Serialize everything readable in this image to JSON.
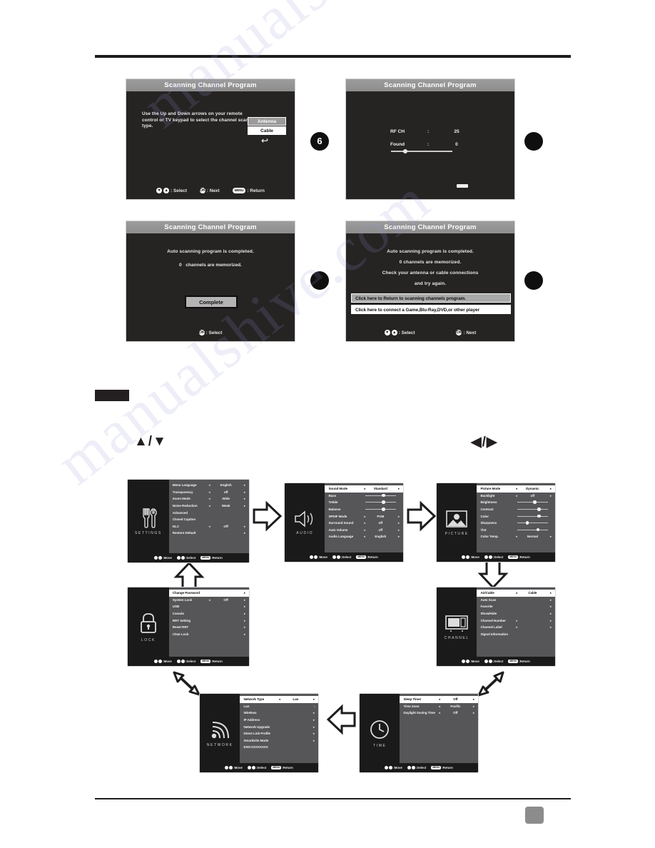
{
  "document": {
    "page_number_box": "",
    "section_tab": ""
  },
  "osd_screens": {
    "scan_type": {
      "title": "Scanning Channel Program",
      "instruction": "Use the Up and Down arrows on your remote control or TV keypad to select the channel scan type.",
      "option_antenna": "Antenna",
      "option_cable": "Cable",
      "return_glyph": "↩",
      "footer": {
        "select_keys": [
          "▼",
          "▲"
        ],
        "select_label": ": Select",
        "next_key": "OK",
        "next_label": ": Next",
        "return_key": "MENU",
        "return_label": ": Return"
      }
    },
    "scan_progress": {
      "title": "Scanning Channel Program",
      "rows": [
        {
          "label": "RF CH",
          "colon": ":",
          "value": "25"
        },
        {
          "label": "Found",
          "colon": ":",
          "value": "0"
        }
      ]
    },
    "scan_complete": {
      "title": "Scanning Channel Program",
      "line1": "Auto scanning program is completed.",
      "line2_count": "0",
      "line2_text": "channels are memorized.",
      "button": "Complete",
      "footer": {
        "key": "OK",
        "label": ": Select"
      }
    },
    "scan_failed": {
      "title": "Scanning Channel Program",
      "line1": "Auto scanning program is completed.",
      "line2": "0 channels are memorized.",
      "line3": "Check your antenna or cable connections",
      "line4": "and try again.",
      "option_return": "Click here to Return to scanning channels program.",
      "option_connect": "Click here to connect a Game,Blu-Ray,DVD,or other player",
      "footer": {
        "select_keys": [
          "▼",
          "▲"
        ],
        "select_label": ": Select",
        "next_key": "OK",
        "next_label": ": Next"
      }
    }
  },
  "markers": {
    "m1": "6",
    "m2": "",
    "m3": "",
    "m4": ""
  },
  "key_hints": {
    "updown": "▲/▼",
    "leftright": "◀/▶"
  },
  "menu_footer": {
    "move_label": ":Move",
    "select_label": ":Select",
    "return_key": "MENU",
    "return_label": ":Return"
  },
  "tv_menus": [
    {
      "id": "settings",
      "category": "SETTINGS",
      "icon": "tools-icon",
      "rows": [
        {
          "name": "Menu Language",
          "value": "English",
          "type": "value",
          "selected": false
        },
        {
          "name": "Transparency",
          "value": "off",
          "type": "value",
          "selected": false
        },
        {
          "name": "Zoom Mode",
          "value": "Wide",
          "type": "value",
          "selected": false
        },
        {
          "name": "Noise Reduction",
          "value": "Weak",
          "type": "value",
          "selected": false
        },
        {
          "name": "Advanced",
          "value": "",
          "type": "plain",
          "selected": false
        },
        {
          "name": "Closed Caption",
          "value": "",
          "type": "plain",
          "selected": false
        },
        {
          "name": "DLC",
          "value": "Off",
          "type": "value",
          "selected": false
        },
        {
          "name": "Restore Default",
          "value": "",
          "type": "plain",
          "selected": false
        }
      ]
    },
    {
      "id": "audio",
      "category": "AUDIO",
      "icon": "speaker-icon",
      "rows": [
        {
          "name": "Sound Mode",
          "value": "Standard",
          "type": "value",
          "selected": true
        },
        {
          "name": "Bass",
          "value": "",
          "type": "slider",
          "pos": 55,
          "selected": false
        },
        {
          "name": "Treble",
          "value": "",
          "type": "slider",
          "pos": 55,
          "selected": false
        },
        {
          "name": "Balance",
          "value": "",
          "type": "slider",
          "pos": 55,
          "selected": false
        },
        {
          "name": "SPDIF Mode",
          "value": "PCM",
          "type": "value",
          "selected": false
        },
        {
          "name": "Surround Sound",
          "value": "off",
          "type": "value",
          "selected": false
        },
        {
          "name": "Auto Volume",
          "value": "off",
          "type": "value",
          "selected": false
        },
        {
          "name": "Audio Language",
          "value": "English",
          "type": "value",
          "selected": false
        }
      ]
    },
    {
      "id": "picture",
      "category": "PICTURE",
      "icon": "image-icon",
      "rows": [
        {
          "name": "Picture Mode",
          "value": "Dynamic",
          "type": "value",
          "selected": true
        },
        {
          "name": "Backlight",
          "value": "off",
          "type": "value",
          "selected": false
        },
        {
          "name": "Brightness",
          "value": "",
          "type": "slider",
          "pos": 52,
          "selected": false
        },
        {
          "name": "Contrast",
          "value": "",
          "type": "slider",
          "pos": 66,
          "selected": false
        },
        {
          "name": "Color",
          "value": "",
          "type": "slider",
          "pos": 66,
          "selected": false
        },
        {
          "name": "Sharpness",
          "value": "",
          "type": "slider",
          "pos": 28,
          "selected": false
        },
        {
          "name": "Tint",
          "value": "",
          "type": "slider",
          "pos": 62,
          "selected": false
        },
        {
          "name": "Color Temp.",
          "value": "Normal",
          "type": "value",
          "selected": false
        }
      ]
    },
    {
      "id": "channel",
      "category": "CHANNEL",
      "icon": "tv-icon",
      "rows": [
        {
          "name": "Air/Cable",
          "value": "Cable",
          "type": "value",
          "selected": true
        },
        {
          "name": "Auto Scan",
          "value": "",
          "type": "arrow",
          "selected": false
        },
        {
          "name": "Favorite",
          "value": "",
          "type": "arrow",
          "selected": false
        },
        {
          "name": "Show/Hide",
          "value": "",
          "type": "arrow",
          "selected": false
        },
        {
          "name": "Channel Number",
          "value": "",
          "type": "arrow",
          "selected": false
        },
        {
          "name": "Channel Label",
          "value": "",
          "type": "arrow",
          "selected": false
        },
        {
          "name": "Signal Information",
          "value": "",
          "type": "plain",
          "selected": false
        }
      ]
    },
    {
      "id": "lock",
      "category": "LOCK",
      "icon": "padlock-icon",
      "rows": [
        {
          "name": "Change Password",
          "value": "",
          "type": "arrow",
          "selected": true
        },
        {
          "name": "System Lock",
          "value": "Off",
          "type": "value",
          "selected": false
        },
        {
          "name": "USB",
          "value": "",
          "type": "arrow",
          "selected": false
        },
        {
          "name": "Canada",
          "value": "",
          "type": "arrow",
          "selected": false
        },
        {
          "name": "RRT Setting",
          "value": "",
          "type": "arrow",
          "selected": false
        },
        {
          "name": "Reset RRT",
          "value": "",
          "type": "arrow",
          "selected": false
        },
        {
          "name": "Clear Lock",
          "value": "",
          "type": "arrow",
          "selected": false
        }
      ]
    },
    {
      "id": "network",
      "category": "NETWORK",
      "icon": "wifi-icon",
      "rows": [
        {
          "name": "Network Type",
          "value": "Lan",
          "type": "value",
          "selected": true
        },
        {
          "name": "Lan",
          "value": "",
          "type": "arrow",
          "selected": false
        },
        {
          "name": "Wireless",
          "value": "",
          "type": "arrow",
          "selected": false
        },
        {
          "name": "IP Address",
          "value": "",
          "type": "arrow",
          "selected": false
        },
        {
          "name": "Network Upgrade",
          "value": "",
          "type": "arrow",
          "selected": false
        },
        {
          "name": "Direct Link Profile",
          "value": "",
          "type": "arrow",
          "selected": false
        },
        {
          "name": "Smartbrite Mode",
          "value": "",
          "type": "arrow",
          "selected": false
        },
        {
          "name": "ESN:XXXXXXXX",
          "value": "",
          "type": "plain",
          "selected": false
        }
      ]
    },
    {
      "id": "time",
      "category": "TIME",
      "icon": "clock-icon",
      "rows": [
        {
          "name": "Sleep Timer",
          "value": "Off",
          "type": "value",
          "selected": true
        },
        {
          "name": "Time Zone",
          "value": "Pacific",
          "type": "value",
          "selected": false
        },
        {
          "name": "Daylight Saving Time",
          "value": "Off",
          "type": "value",
          "selected": false
        }
      ]
    }
  ],
  "watermark": {
    "line1": "manualshive.com",
    "line2": "manualshive.com"
  }
}
